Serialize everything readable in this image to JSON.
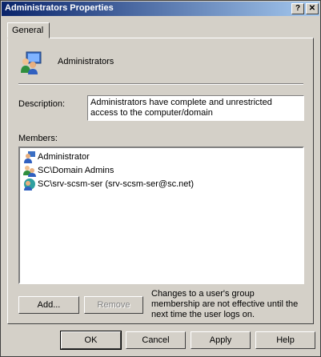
{
  "window": {
    "title": "Administrators Properties",
    "help_btn": "?",
    "close_btn": "✕"
  },
  "tabs": [
    {
      "label": "General"
    }
  ],
  "group": {
    "name": "Administrators"
  },
  "description": {
    "label": "Description:",
    "value": "Administrators have complete and unrestricted access to the computer/domain"
  },
  "members": {
    "label": "Members:",
    "items": [
      {
        "name": "Administrator",
        "icon": "user-icon"
      },
      {
        "name": "SC\\Domain Admins",
        "icon": "group-icon"
      },
      {
        "name": "SC\\srv-scsm-ser (srv-scsm-ser@sc.net)",
        "icon": "user-icon"
      }
    ]
  },
  "buttons": {
    "add": "Add...",
    "remove": "Remove",
    "ok": "OK",
    "cancel": "Cancel",
    "apply": "Apply",
    "help": "Help"
  },
  "note": "Changes to a user's group membership are not effective until the next time the user logs on."
}
